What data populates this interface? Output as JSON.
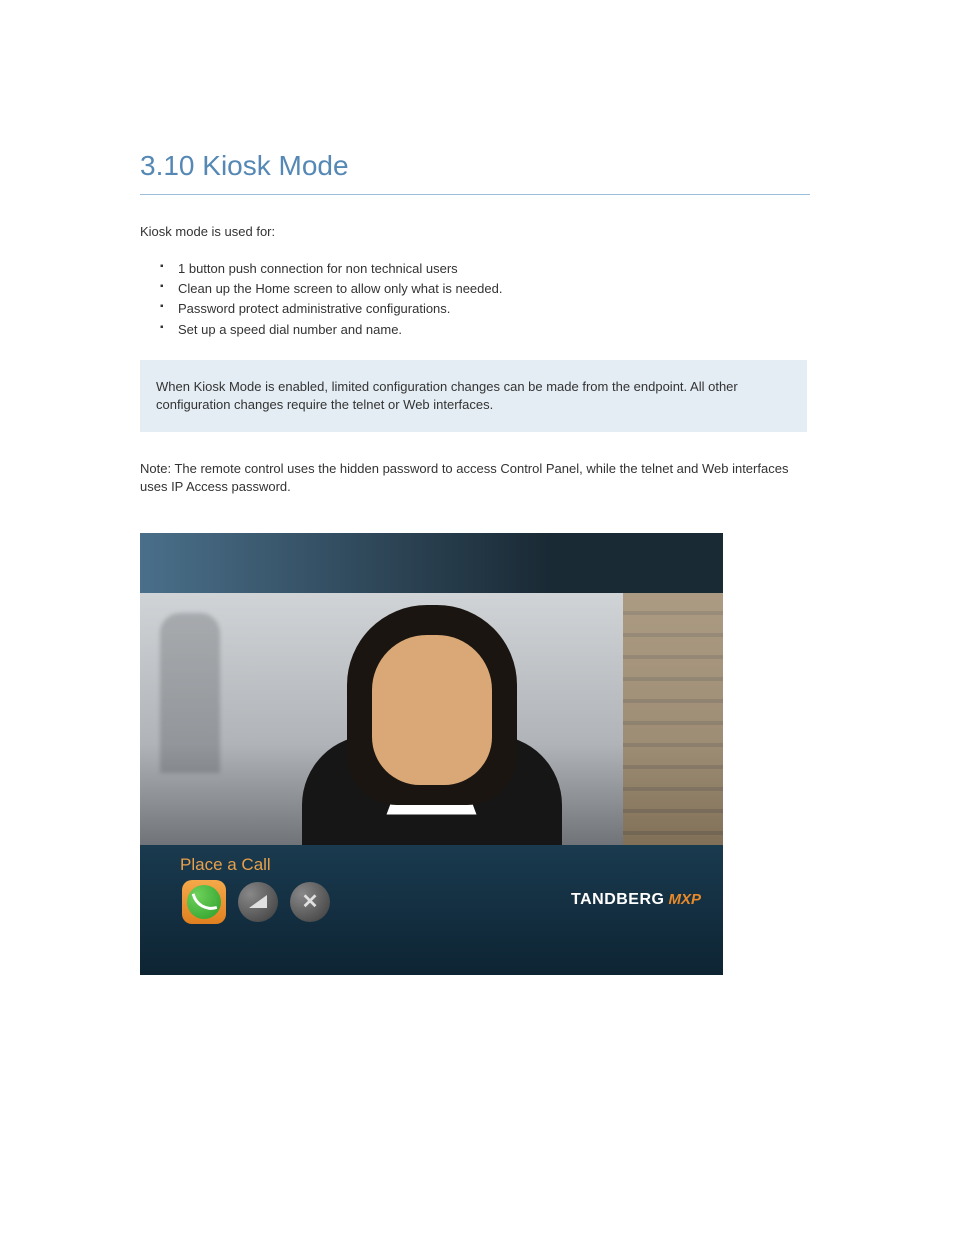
{
  "section": {
    "title": "3.10 Kiosk Mode",
    "intro": "Kiosk mode is used for:",
    "bullets": [
      "1 button push connection for non technical users",
      "Clean up the Home screen to allow only what is needed.",
      "Password protect administrative configurations.",
      "Set up a speed dial number and name."
    ],
    "callout": "When Kiosk Mode is enabled, limited configuration changes can be made from the endpoint. All other configuration changes require the telnet or Web interfaces.",
    "note": "Note: The remote control uses the hidden password to access Control Panel, while the telnet and Web interfaces uses IP Access password."
  },
  "video": {
    "label": "Place a Call",
    "brand_main": "TANDBERG",
    "brand_sub": "MXP",
    "icons": {
      "call": "call-icon",
      "volume": "volume-icon",
      "close": "close-icon"
    }
  }
}
